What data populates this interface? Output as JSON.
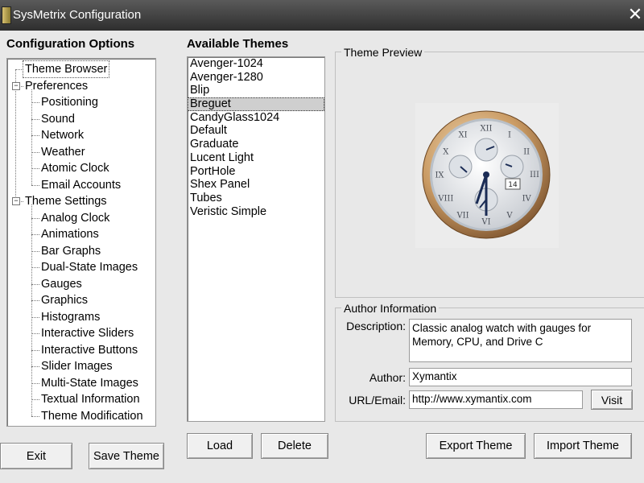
{
  "window": {
    "title": "SysMetrix Configuration",
    "close_glyph": "✕"
  },
  "options": {
    "heading": "Configuration Options",
    "tree": [
      {
        "label": "Theme Browser",
        "level": 0,
        "selected": true
      },
      {
        "label": "Preferences",
        "level": 0,
        "expander": "-"
      },
      {
        "label": "Positioning",
        "level": 1
      },
      {
        "label": "Sound",
        "level": 1
      },
      {
        "label": "Network",
        "level": 1
      },
      {
        "label": "Weather",
        "level": 1
      },
      {
        "label": "Atomic Clock",
        "level": 1
      },
      {
        "label": "Email Accounts",
        "level": 1
      },
      {
        "label": "Theme Settings",
        "level": 0,
        "expander": "-"
      },
      {
        "label": "Analog Clock",
        "level": 1
      },
      {
        "label": "Animations",
        "level": 1
      },
      {
        "label": "Bar Graphs",
        "level": 1
      },
      {
        "label": "Dual-State Images",
        "level": 1
      },
      {
        "label": "Gauges",
        "level": 1
      },
      {
        "label": "Graphics",
        "level": 1
      },
      {
        "label": "Histograms",
        "level": 1
      },
      {
        "label": "Interactive Sliders",
        "level": 1
      },
      {
        "label": "Interactive Buttons",
        "level": 1
      },
      {
        "label": "Slider Images",
        "level": 1
      },
      {
        "label": "Multi-State Images",
        "level": 1
      },
      {
        "label": "Textual Information",
        "level": 1
      },
      {
        "label": "Theme Modification",
        "level": 1
      }
    ],
    "exit_label": "Exit",
    "save_label": "Save Theme"
  },
  "themes": {
    "heading": "Available Themes",
    "items": [
      "Avenger-1024",
      "Avenger-1280",
      "Blip",
      "Breguet",
      "CandyGlass1024",
      "Default",
      "Graduate",
      "Lucent Light",
      "PortHole",
      "Shex Panel",
      "Tubes",
      "Veristic Simple"
    ],
    "selected": "Breguet",
    "load_label": "Load",
    "delete_label": "Delete"
  },
  "preview": {
    "label": "Theme Preview",
    "image_icon": "analog-watch",
    "date_window": "14",
    "numerals": [
      "XII",
      "III",
      "VI",
      "IX",
      "I",
      "II",
      "IV",
      "V",
      "VII",
      "VIII",
      "X",
      "XI"
    ]
  },
  "author": {
    "label": "Author Information",
    "description_label": "Description:",
    "description": "Classic analog watch with gauges for Memory, CPU, and Drive C",
    "author_label": "Author:",
    "author": "Xymantix",
    "url_label": "URL/Email:",
    "url": "http://www.xymantix.com",
    "visit_label": "Visit"
  },
  "actions": {
    "export_label": "Export Theme",
    "import_label": "Import Theme"
  }
}
